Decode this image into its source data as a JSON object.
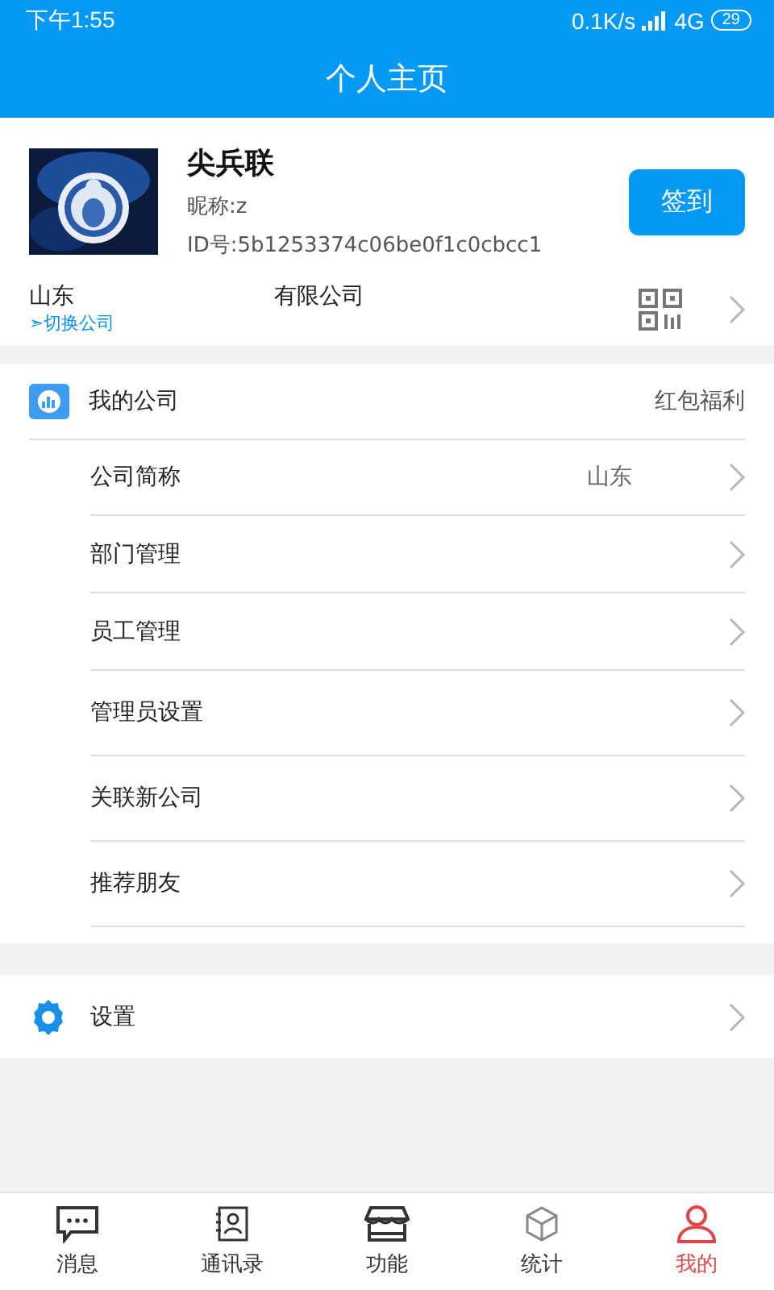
{
  "status_bar": {
    "time": "下午1:55",
    "speed": "0.1K/s",
    "network": "4G",
    "battery": "29"
  },
  "header": {
    "title": "个人主页"
  },
  "profile": {
    "name": "尖兵联",
    "nickname": "昵称:z",
    "id": "ID号:5b1253374c06be0f1c0cbcc1",
    "sign_button": "签到"
  },
  "company": {
    "name_start": "山东",
    "name_end": "有限公司",
    "switch_link": "➣切换公司"
  },
  "my_company": {
    "title": "我的公司",
    "extra": "红包福利",
    "items": [
      {
        "label": "公司简称",
        "value": "山东"
      },
      {
        "label": "部门管理"
      },
      {
        "label": "员工管理"
      },
      {
        "label": "管理员设置"
      },
      {
        "label": "关联新公司"
      },
      {
        "label": "推荐朋友"
      }
    ]
  },
  "settings": {
    "label": "设置"
  },
  "tabs": [
    {
      "label": "消息",
      "selected": false
    },
    {
      "label": "通讯录",
      "selected": false
    },
    {
      "label": "功能",
      "selected": false
    },
    {
      "label": "统计",
      "selected": false
    },
    {
      "label": "我的",
      "selected": true
    }
  ]
}
